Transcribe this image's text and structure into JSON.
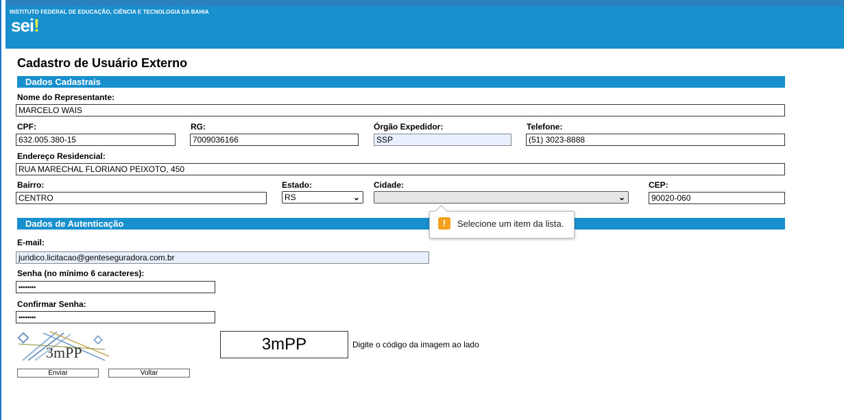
{
  "header": {
    "institute": "INSTITUTO FEDERAL DE EDUCAÇÃO, CIÊNCIA E TECNOLOGIA DA BAHIA",
    "logo_text": "sei",
    "logo_dot": "!"
  },
  "page": {
    "title": "Cadastro de Usuário Externo"
  },
  "sections": {
    "cadastrais": "Dados Cadastrais",
    "autenticacao": "Dados de Autenticação"
  },
  "fields": {
    "nome": {
      "label": "Nome do Representante:",
      "value": "MARCELO WAIS"
    },
    "cpf": {
      "label": "CPF:",
      "value": "632.005.380-15"
    },
    "rg": {
      "label": "RG:",
      "value": "7009036166"
    },
    "orgao": {
      "label": "Órgão Expedidor:",
      "value": "SSP"
    },
    "telefone": {
      "label": "Telefone:",
      "value": "(51) 3023-8888"
    },
    "endereco": {
      "label": "Endereço Residencial:",
      "value": "RUA MARECHAL FLORIANO PEIXOTO, 450"
    },
    "bairro": {
      "label": "Bairro:",
      "value": "CENTRO"
    },
    "estado": {
      "label": "Estado:",
      "value": "RS"
    },
    "cidade": {
      "label": "Cidade:",
      "value": ""
    },
    "cep": {
      "label": "CEP:",
      "value": "90020-060"
    },
    "email": {
      "label": "E-mail:",
      "value": "juridico.licitacao@genteseguradora.com.br"
    },
    "senha": {
      "label": "Senha (no mínimo 6 caracteres):",
      "value": "••••••••"
    },
    "confirmar": {
      "label": "Confirmar Senha:",
      "value": "••••••••"
    }
  },
  "tooltip": {
    "text": "Selecione um item da lista.",
    "icon": "warning-icon"
  },
  "captcha": {
    "image_text": "3mPP",
    "code": "3mPP",
    "hint": "Digite o código da imagem ao lado"
  },
  "buttons": {
    "enviar": "Enviar",
    "voltar": "Voltar"
  },
  "colors": {
    "banner": "#1990ce",
    "accent_dot": "#e6f23a",
    "warning": "#f3a11f"
  }
}
